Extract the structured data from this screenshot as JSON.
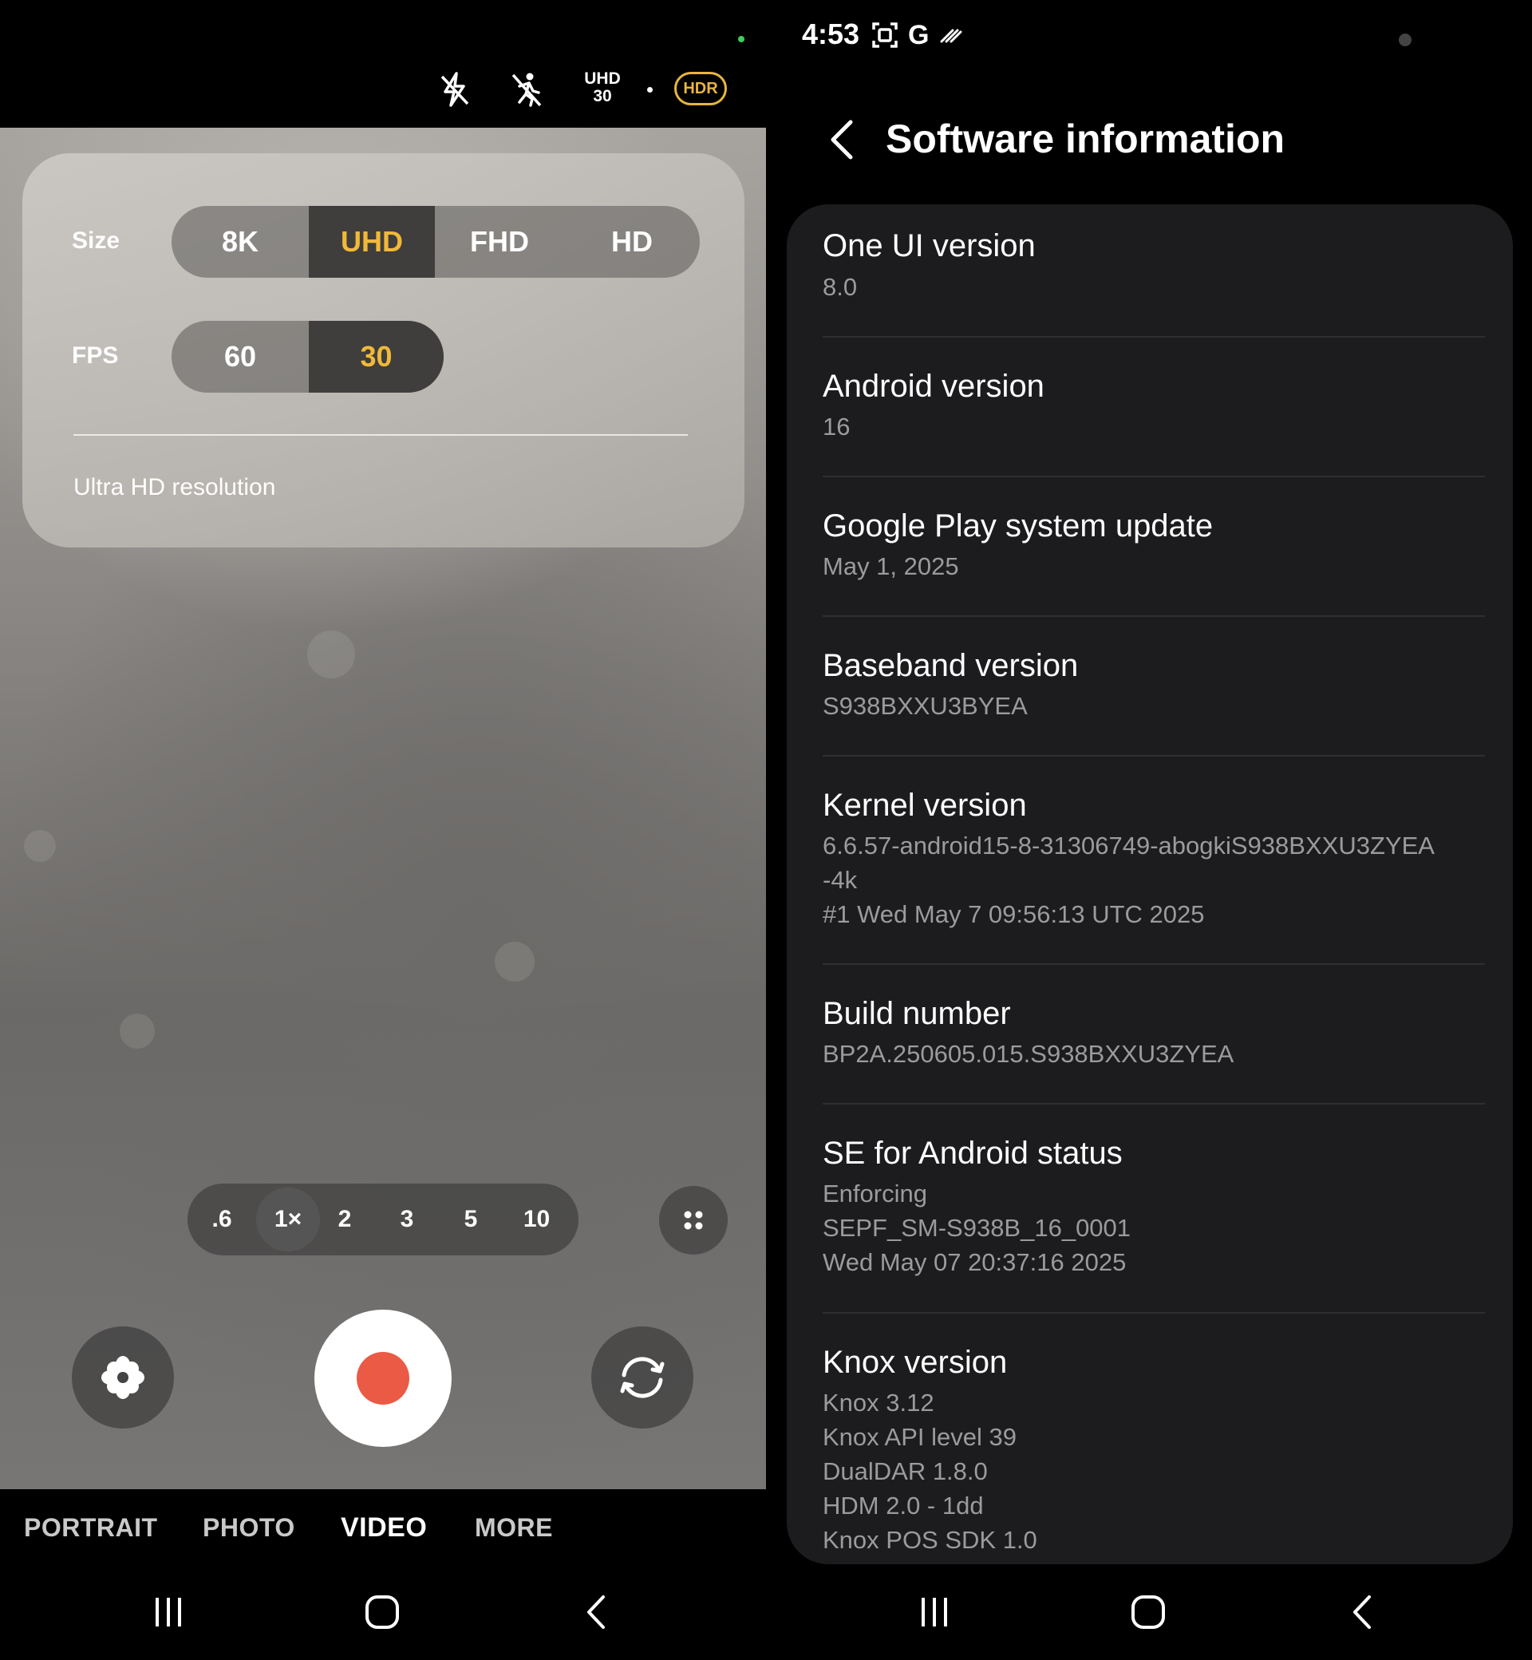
{
  "camera": {
    "topbar": {
      "flash_icon": "flash-off-icon",
      "motion_icon": "motion-off-icon",
      "quality_line1": "UHD",
      "quality_line2": "30",
      "hdr_label": "HDR"
    },
    "settings_card": {
      "size_label": "Size",
      "size_options": [
        "8K",
        "UHD",
        "FHD",
        "HD"
      ],
      "size_selected": "UHD",
      "fps_label": "FPS",
      "fps_options": [
        "60",
        "30"
      ],
      "fps_selected": "30",
      "description": "Ultra HD resolution"
    },
    "zoom_levels": [
      ".6",
      "1×",
      "2",
      "3",
      "5",
      "10"
    ],
    "zoom_selected": "1×",
    "modes": [
      "PORTRAIT",
      "PHOTO",
      "VIDEO",
      "MORE"
    ],
    "mode_selected": "VIDEO",
    "accent_color": "#f1b93a",
    "record_color": "#ea5a45"
  },
  "settings": {
    "status_time": "4:53",
    "status_network": "G",
    "page_title": "Software information",
    "items": [
      {
        "title": "One UI version",
        "value": "8.0"
      },
      {
        "title": "Android version",
        "value": "16"
      },
      {
        "title": "Google Play system update",
        "value": "May 1, 2025"
      },
      {
        "title": "Baseband version",
        "value": "S938BXXU3BYEA"
      },
      {
        "title": "Kernel version",
        "value_lines": [
          "6.6.57-android15-8-31306749-abogkiS938BXXU3ZYEA",
          "-4k",
          "#1 Wed May  7 09:56:13 UTC 2025"
        ]
      },
      {
        "title": "Build number",
        "value": "BP2A.250605.015.S938BXXU3ZYEA"
      },
      {
        "title": "SE for Android status",
        "value_lines": [
          "Enforcing",
          "SEPF_SM-S938B_16_0001",
          "Wed May 07 20:37:16 2025"
        ]
      },
      {
        "title": "Knox version",
        "value_lines": [
          "Knox 3.12",
          "Knox API level 39",
          "DualDAR 1.8.0",
          "HDM 2.0 - 1dd",
          "Knox POS SDK 1.0"
        ]
      }
    ]
  }
}
